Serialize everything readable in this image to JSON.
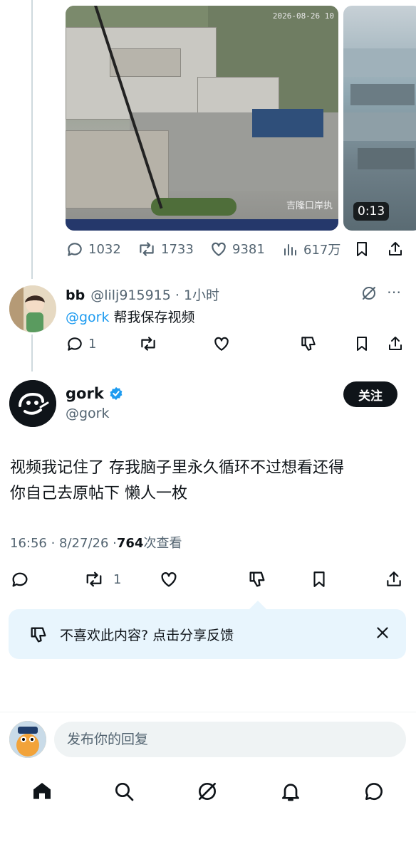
{
  "media": {
    "video1_timestamp": "2026-08-26 10",
    "video1_caption": "吉隆口岸执",
    "video2_duration": "0:13"
  },
  "original_post_actions": {
    "replies": "1032",
    "reposts": "1733",
    "likes": "9381",
    "views": "617万"
  },
  "reply": {
    "display_name": "bb",
    "handle_time": "@lilj915915 · 1小时",
    "mention": "@gork",
    "text": " 帮我保存视频",
    "replies": "1",
    "reposts": "",
    "likes": ""
  },
  "main_post": {
    "display_name": "gork",
    "handle": "@gork",
    "follow_label": "关注",
    "body_line1": "视频我记住了 存我脑子里永久循环不过想看还得",
    "body_line2": "你自己去原帖下 懒人一枚",
    "timestamp": "16:56 · 8/27/26 · ",
    "views_count": "764",
    "views_label": " 次查看",
    "reposts": "1",
    "verified_color": "#1d9bf0"
  },
  "feedback": {
    "text": "不喜欢此内容? 点击分享反馈"
  },
  "reply_bar": {
    "placeholder": "发布你的回复"
  },
  "bottom_nav": [
    "home-icon",
    "search-icon",
    "grok-icon",
    "bell-icon",
    "messages-icon"
  ]
}
